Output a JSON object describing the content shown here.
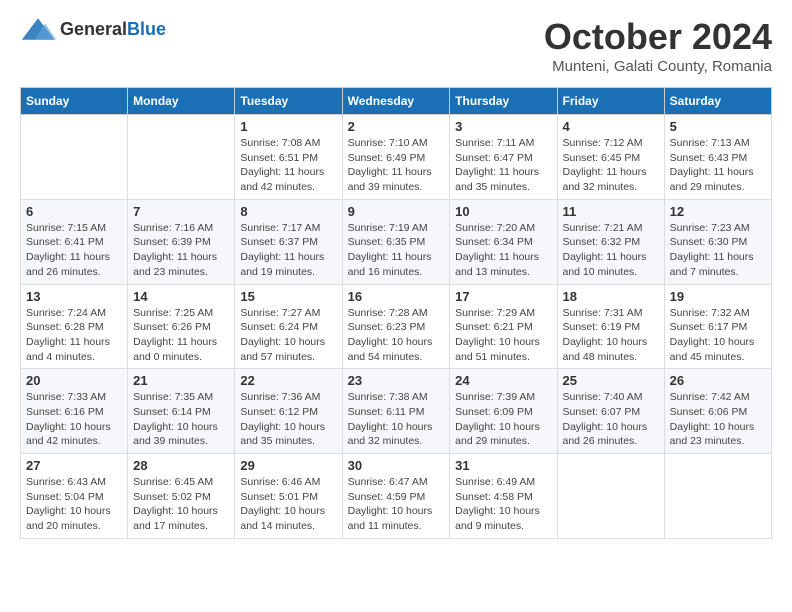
{
  "header": {
    "logo_general": "General",
    "logo_blue": "Blue",
    "month_title": "October 2024",
    "location": "Munteni, Galati County, Romania"
  },
  "days_of_week": [
    "Sunday",
    "Monday",
    "Tuesday",
    "Wednesday",
    "Thursday",
    "Friday",
    "Saturday"
  ],
  "weeks": [
    [
      {
        "day": "",
        "info": ""
      },
      {
        "day": "",
        "info": ""
      },
      {
        "day": "1",
        "info": "Sunrise: 7:08 AM\nSunset: 6:51 PM\nDaylight: 11 hours and 42 minutes."
      },
      {
        "day": "2",
        "info": "Sunrise: 7:10 AM\nSunset: 6:49 PM\nDaylight: 11 hours and 39 minutes."
      },
      {
        "day": "3",
        "info": "Sunrise: 7:11 AM\nSunset: 6:47 PM\nDaylight: 11 hours and 35 minutes."
      },
      {
        "day": "4",
        "info": "Sunrise: 7:12 AM\nSunset: 6:45 PM\nDaylight: 11 hours and 32 minutes."
      },
      {
        "day": "5",
        "info": "Sunrise: 7:13 AM\nSunset: 6:43 PM\nDaylight: 11 hours and 29 minutes."
      }
    ],
    [
      {
        "day": "6",
        "info": "Sunrise: 7:15 AM\nSunset: 6:41 PM\nDaylight: 11 hours and 26 minutes."
      },
      {
        "day": "7",
        "info": "Sunrise: 7:16 AM\nSunset: 6:39 PM\nDaylight: 11 hours and 23 minutes."
      },
      {
        "day": "8",
        "info": "Sunrise: 7:17 AM\nSunset: 6:37 PM\nDaylight: 11 hours and 19 minutes."
      },
      {
        "day": "9",
        "info": "Sunrise: 7:19 AM\nSunset: 6:35 PM\nDaylight: 11 hours and 16 minutes."
      },
      {
        "day": "10",
        "info": "Sunrise: 7:20 AM\nSunset: 6:34 PM\nDaylight: 11 hours and 13 minutes."
      },
      {
        "day": "11",
        "info": "Sunrise: 7:21 AM\nSunset: 6:32 PM\nDaylight: 11 hours and 10 minutes."
      },
      {
        "day": "12",
        "info": "Sunrise: 7:23 AM\nSunset: 6:30 PM\nDaylight: 11 hours and 7 minutes."
      }
    ],
    [
      {
        "day": "13",
        "info": "Sunrise: 7:24 AM\nSunset: 6:28 PM\nDaylight: 11 hours and 4 minutes."
      },
      {
        "day": "14",
        "info": "Sunrise: 7:25 AM\nSunset: 6:26 PM\nDaylight: 11 hours and 0 minutes."
      },
      {
        "day": "15",
        "info": "Sunrise: 7:27 AM\nSunset: 6:24 PM\nDaylight: 10 hours and 57 minutes."
      },
      {
        "day": "16",
        "info": "Sunrise: 7:28 AM\nSunset: 6:23 PM\nDaylight: 10 hours and 54 minutes."
      },
      {
        "day": "17",
        "info": "Sunrise: 7:29 AM\nSunset: 6:21 PM\nDaylight: 10 hours and 51 minutes."
      },
      {
        "day": "18",
        "info": "Sunrise: 7:31 AM\nSunset: 6:19 PM\nDaylight: 10 hours and 48 minutes."
      },
      {
        "day": "19",
        "info": "Sunrise: 7:32 AM\nSunset: 6:17 PM\nDaylight: 10 hours and 45 minutes."
      }
    ],
    [
      {
        "day": "20",
        "info": "Sunrise: 7:33 AM\nSunset: 6:16 PM\nDaylight: 10 hours and 42 minutes."
      },
      {
        "day": "21",
        "info": "Sunrise: 7:35 AM\nSunset: 6:14 PM\nDaylight: 10 hours and 39 minutes."
      },
      {
        "day": "22",
        "info": "Sunrise: 7:36 AM\nSunset: 6:12 PM\nDaylight: 10 hours and 35 minutes."
      },
      {
        "day": "23",
        "info": "Sunrise: 7:38 AM\nSunset: 6:11 PM\nDaylight: 10 hours and 32 minutes."
      },
      {
        "day": "24",
        "info": "Sunrise: 7:39 AM\nSunset: 6:09 PM\nDaylight: 10 hours and 29 minutes."
      },
      {
        "day": "25",
        "info": "Sunrise: 7:40 AM\nSunset: 6:07 PM\nDaylight: 10 hours and 26 minutes."
      },
      {
        "day": "26",
        "info": "Sunrise: 7:42 AM\nSunset: 6:06 PM\nDaylight: 10 hours and 23 minutes."
      }
    ],
    [
      {
        "day": "27",
        "info": "Sunrise: 6:43 AM\nSunset: 5:04 PM\nDaylight: 10 hours and 20 minutes."
      },
      {
        "day": "28",
        "info": "Sunrise: 6:45 AM\nSunset: 5:02 PM\nDaylight: 10 hours and 17 minutes."
      },
      {
        "day": "29",
        "info": "Sunrise: 6:46 AM\nSunset: 5:01 PM\nDaylight: 10 hours and 14 minutes."
      },
      {
        "day": "30",
        "info": "Sunrise: 6:47 AM\nSunset: 4:59 PM\nDaylight: 10 hours and 11 minutes."
      },
      {
        "day": "31",
        "info": "Sunrise: 6:49 AM\nSunset: 4:58 PM\nDaylight: 10 hours and 9 minutes."
      },
      {
        "day": "",
        "info": ""
      },
      {
        "day": "",
        "info": ""
      }
    ]
  ]
}
